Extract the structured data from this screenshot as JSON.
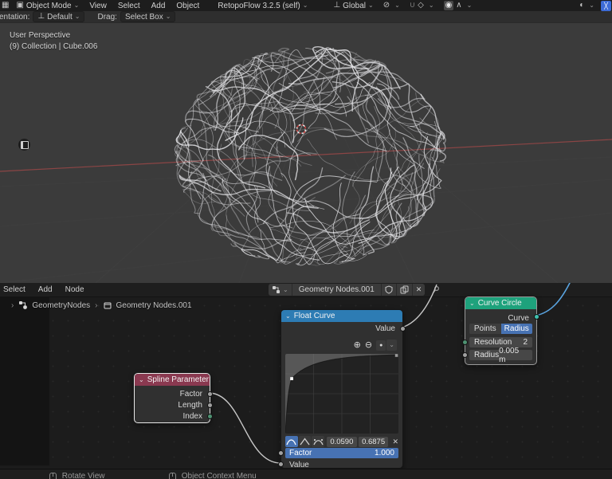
{
  "topbar": {
    "mode": "Object Mode",
    "menus": [
      "View",
      "Select",
      "Add",
      "Object"
    ],
    "addon": "RetopoFlow 3.2.5 (self)",
    "orientation": "Global"
  },
  "tool_settings": {
    "orientation_label": "entation:",
    "orientation_value": "Default",
    "drag_label": "Drag:",
    "drag_value": "Select Box"
  },
  "viewport": {
    "view_label": "User Perspective",
    "context_label": "(9) Collection | Cube.006"
  },
  "node_editor": {
    "menus": [
      "Select",
      "Add",
      "Node"
    ],
    "tree_name": "Geometry Nodes.001",
    "breadcrumb": [
      "GeometryNodes",
      "Geometry Nodes.001"
    ]
  },
  "nodes": {
    "spline_parameter": {
      "title": "Spline Parameter",
      "outputs": [
        "Factor",
        "Length",
        "Index"
      ]
    },
    "float_curve": {
      "title": "Float Curve",
      "output_label": "Value",
      "selected_point_x": "0.0590",
      "selected_point_y": "0.6875",
      "factor_label": "Factor",
      "factor_value": "1.000",
      "input_label": "Value",
      "curve_point": {
        "x": 0.059,
        "y": 0.6875
      }
    },
    "curve_circle": {
      "title": "Curve Circle",
      "output_label": "Curve",
      "points_label": "Points",
      "radius_mode_label": "Radius",
      "resolution_label": "Resolution",
      "resolution_value": "2",
      "radius_label": "Radius",
      "radius_value": "0.005 m"
    }
  },
  "status_bar": {
    "rotate_view": "Rotate View",
    "object_context_menu": "Object Context Menu"
  },
  "icons": {
    "chevron": "⌄",
    "editor_type": "▦",
    "mode": "▣",
    "orientation": "⊥",
    "pivot": "⊘",
    "magnet": "∪",
    "snap_target": "◇",
    "proportional": "◉",
    "falloff": "∧",
    "shading": "◐",
    "corner_tool": "╳",
    "zoom_in": "⊕",
    "zoom_out": "⊖",
    "options_dot": "●",
    "close": "✕",
    "separator": "›"
  },
  "colors": {
    "accent": "#4772b3",
    "header_input": "#8a3950",
    "header_converter": "#2d7cb4",
    "header_geometry": "#1ea27c",
    "socket_float": "#a1a1a1",
    "socket_int": "#4e9272",
    "socket_geometry": "#3ec1af",
    "wire_gray": "#c9c9c9",
    "wire_blue": "#5aa4e0",
    "axis_red": "#a04848"
  }
}
